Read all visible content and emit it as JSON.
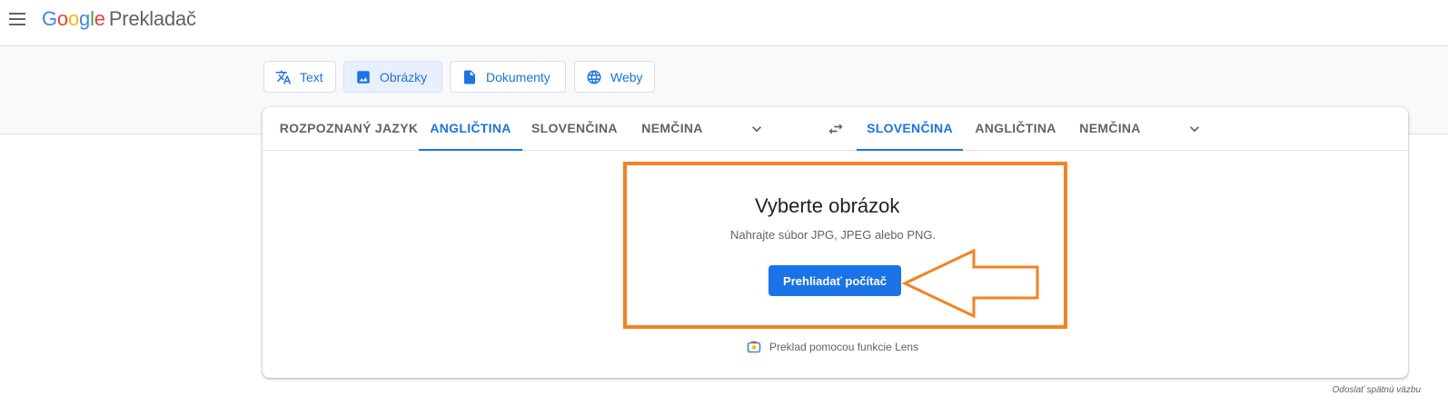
{
  "header": {
    "logo_letters": [
      "G",
      "o",
      "o",
      "g",
      "l",
      "e"
    ],
    "product": "Prekladač"
  },
  "modes": [
    {
      "label": "Text",
      "icon": "translate-icon",
      "active": false
    },
    {
      "label": "Obrázky",
      "icon": "image-icon",
      "active": true
    },
    {
      "label": "Dokumenty",
      "icon": "document-icon",
      "active": false
    },
    {
      "label": "Weby",
      "icon": "globe-icon",
      "active": false
    }
  ],
  "source_langs": [
    {
      "label": "ROZPOZNANÝ JAZYK",
      "active": false
    },
    {
      "label": "ANGLIČTINA",
      "active": true
    },
    {
      "label": "SLOVENČINA",
      "active": false
    },
    {
      "label": "NEMČINA",
      "active": false
    }
  ],
  "target_langs": [
    {
      "label": "SLOVENČINA",
      "active": true
    },
    {
      "label": "ANGLIČTINA",
      "active": false
    },
    {
      "label": "NEMČINA",
      "active": false
    }
  ],
  "upload": {
    "title": "Vyberte obrázok",
    "subtitle": "Nahrajte súbor JPG, JPEG alebo PNG.",
    "button": "Prehliadať počítač"
  },
  "lens": {
    "label": "Preklad pomocou funkcie Lens"
  },
  "footer": {
    "feedback": "Odoslať spätnú väzbu"
  },
  "colors": {
    "accent": "#1a73e8",
    "highlight": "#f58220"
  }
}
